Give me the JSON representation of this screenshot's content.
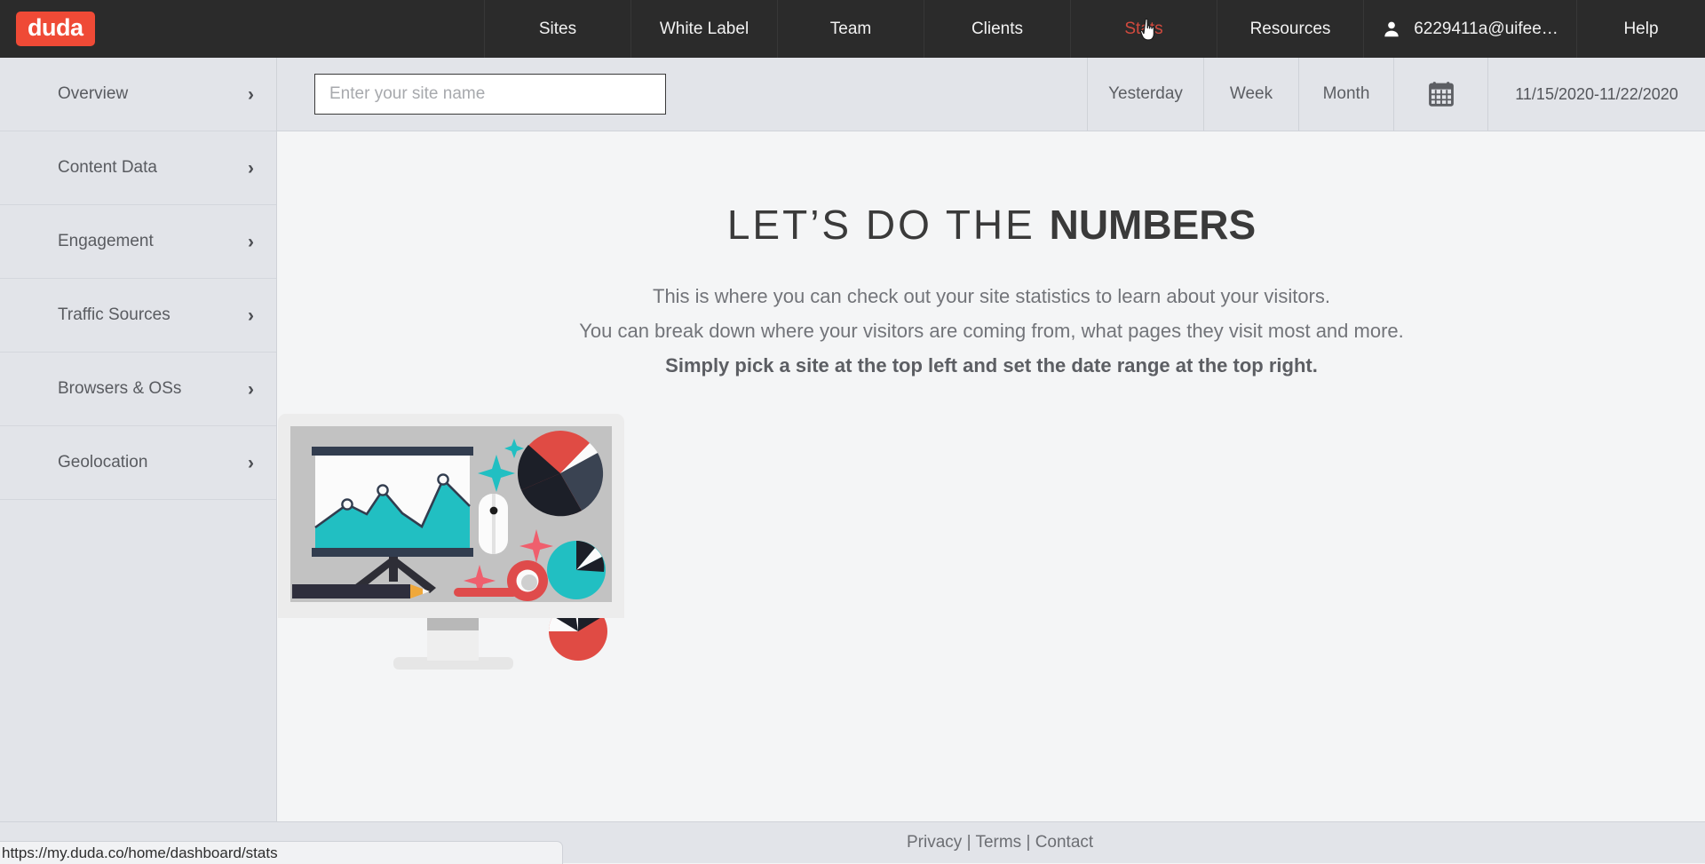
{
  "brand": {
    "logo_text": "duda",
    "logo_color": "#ef4a36"
  },
  "topnav": {
    "items": [
      {
        "label": "Sites",
        "name": "sites"
      },
      {
        "label": "White Label",
        "name": "white-label"
      },
      {
        "label": "Team",
        "name": "team"
      },
      {
        "label": "Clients",
        "name": "clients"
      },
      {
        "label": "Stats",
        "name": "stats",
        "active": true,
        "active_color": "#d24a3e"
      },
      {
        "label": "Resources",
        "name": "resources"
      }
    ],
    "user": {
      "email": "6229411a@uifee…",
      "icon": "user-icon"
    },
    "help_label": "Help"
  },
  "sidebar": {
    "items": [
      {
        "label": "Overview",
        "icon": "chevron-right-icon"
      },
      {
        "label": "Content Data",
        "icon": "chevron-right-icon"
      },
      {
        "label": "Engagement",
        "icon": "chevron-right-icon"
      },
      {
        "label": "Traffic Sources",
        "icon": "chevron-right-icon"
      },
      {
        "label": "Browsers & OSs",
        "icon": "chevron-right-icon"
      },
      {
        "label": "Geolocation",
        "icon": "chevron-right-icon"
      }
    ]
  },
  "toolbar": {
    "site_input": {
      "value": "",
      "placeholder": "Enter your site name"
    },
    "yesterday_label": "Yesterday",
    "week_label": "Week",
    "month_label": "Month",
    "calendar_icon": "calendar-icon",
    "date_range": "11/15/2020-11/22/2020"
  },
  "main": {
    "heading_light": "LET’S DO THE ",
    "heading_bold": "NUMBERS",
    "line1": "This is where you can check out your site statistics to learn about your visitors.",
    "line2": "You can break down where your visitors are coming from, what pages they visit most and more.",
    "line3": "Simply pick a site at the top left and set the date range at the top right.",
    "illustration": "stats-monitor-illustration"
  },
  "footer": {
    "privacy": "Privacy",
    "sep1": " | ",
    "terms": "Terms",
    "sep2": " | ",
    "contact": "Contact"
  },
  "statusbar": {
    "url": "https://my.duda.co/home/dashboard/stats"
  }
}
